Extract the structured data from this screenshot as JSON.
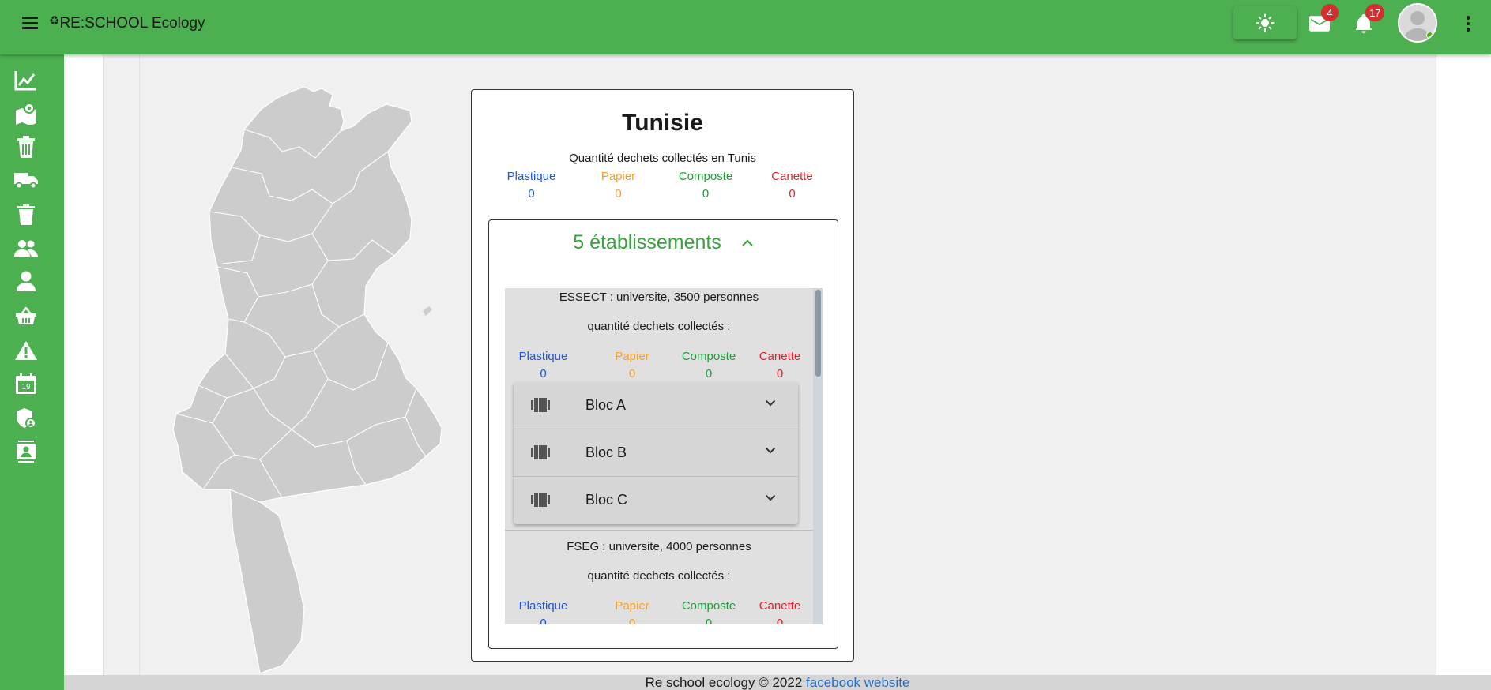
{
  "app": {
    "title": "RE:SCHOOL Ecology",
    "brand_color": "#4caf50"
  },
  "header": {
    "messages_badge": "4",
    "notifications_badge": "17",
    "icons": [
      "menu-icon",
      "recycle-icon",
      "sun-icon",
      "mail-icon",
      "bell-icon",
      "avatar",
      "more-vert-icon"
    ]
  },
  "sidebar": {
    "items": [
      {
        "icon": "chart-line-icon"
      },
      {
        "icon": "map-marker-icon"
      },
      {
        "icon": "trash-can-icon"
      },
      {
        "icon": "truck-icon"
      },
      {
        "icon": "delete-icon"
      },
      {
        "icon": "people-icon"
      },
      {
        "icon": "person-icon"
      },
      {
        "icon": "basket-icon"
      },
      {
        "icon": "warning-icon"
      },
      {
        "icon": "calendar-icon"
      },
      {
        "icon": "shield-user-icon"
      },
      {
        "icon": "contact-card-icon"
      }
    ]
  },
  "region": {
    "title": "Tunisie",
    "subtitle": "Quantité dechets collectés en Tunis",
    "stats": {
      "plastique_label": "Plastique",
      "plastique": "0",
      "papier_label": "Papier",
      "papier": "0",
      "composte_label": "Composte",
      "composte": "0",
      "canette_label": "Canette",
      "canette": "0"
    }
  },
  "etablissements": {
    "header": "5 établissements",
    "items": [
      {
        "title": "ESSECT : universite, 3500 personnes",
        "qty_label": "quantité dechets collectés :",
        "plastique_label": "Plastique",
        "plastique": "0",
        "papier_label": "Papier",
        "papier": "0",
        "composte_label": "Composte",
        "composte": "0",
        "canette_label": "Canette",
        "canette": "0",
        "blocs": [
          "Bloc A",
          "Bloc B",
          "Bloc C"
        ]
      },
      {
        "title": "FSEG : universite, 4000 personnes",
        "qty_label": "quantité dechets collectés :",
        "plastique_label": "Plastique",
        "plastique": "0",
        "papier_label": "Papier",
        "papier": "0",
        "composte_label": "Composte",
        "composte": "0",
        "canette_label": "Canette",
        "canette": "0"
      }
    ]
  },
  "colors": {
    "plastique": "#1e56e0",
    "papier": "#f9a02a",
    "composte": "#1f9d3a",
    "canette": "#e31d2c"
  },
  "footer": {
    "text": "Re school ecology © 2022",
    "link": "facebook website"
  }
}
